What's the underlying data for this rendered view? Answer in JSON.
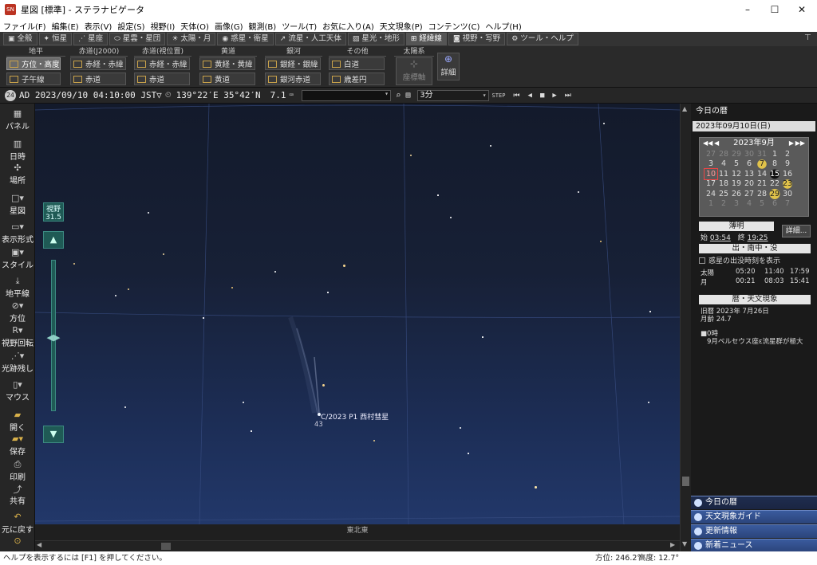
{
  "window": {
    "title": "星図 [標準] - ステラナビゲータ",
    "icon": "app-logo-icon"
  },
  "menu": [
    "ファイル(F)",
    "編集(E)",
    "表示(V)",
    "設定(S)",
    "視野(I)",
    "天体(O)",
    "画像(G)",
    "観測(B)",
    "ツール(T)",
    "お気に入り(A)",
    "天文現象(P)",
    "コンテンツ(C)",
    "ヘルプ(H)"
  ],
  "tabs": [
    {
      "label": "全般",
      "icon": "panel-icon"
    },
    {
      "label": "恒星",
      "icon": "star-icon"
    },
    {
      "label": "星座",
      "icon": "constellation-icon"
    },
    {
      "label": "星雲・星団",
      "icon": "nebula-icon"
    },
    {
      "label": "太陽・月",
      "icon": "sun-icon"
    },
    {
      "label": "惑星・衛星",
      "icon": "planet-icon"
    },
    {
      "label": "流星・人工天体",
      "icon": "meteor-icon"
    },
    {
      "label": "星光・地形",
      "icon": "landscape-icon"
    },
    {
      "label": "経緯線",
      "icon": "grid-icon",
      "active": true
    },
    {
      "label": "視野・写野",
      "icon": "camera-icon"
    },
    {
      "label": "ツール・ヘルプ",
      "icon": "gear-icon"
    }
  ],
  "ribbon": {
    "groups": [
      {
        "label": "地平",
        "buttons": [
          "方位・高度",
          "子午線"
        ]
      },
      {
        "label": "赤道(J2000)",
        "buttons": [
          "赤経・赤緯",
          "赤道"
        ]
      },
      {
        "label": "赤道(視位置)",
        "buttons": [
          "赤経・赤緯",
          "赤道"
        ]
      },
      {
        "label": "黄道",
        "buttons": [
          "黄経・黄緯",
          "黄道"
        ]
      },
      {
        "label": "銀河",
        "buttons": [
          "銀経・銀緯",
          "銀河赤道"
        ]
      },
      {
        "label": "その他",
        "buttons": [
          "白道",
          "歳差円"
        ]
      },
      {
        "label": "太陽系",
        "buttons": [
          "座標軸"
        ]
      }
    ],
    "detail_label": "詳細"
  },
  "toolbar": {
    "datetime": "AD 2023/09/10 04:10:00 JST▽",
    "location": "139°22′E 35°42′N",
    "magnitude": "7.1",
    "search_value": "",
    "step_value": "3分"
  },
  "left_panel": [
    "パネル",
    "日時",
    "場所",
    "星図",
    "表示形式",
    "スタイル",
    "地平線",
    "方位",
    "視野回転",
    "光跡残し",
    "マウス",
    "開く",
    "保存",
    "印刷",
    "共有",
    "元に戻す"
  ],
  "sky": {
    "fov_label": "視野",
    "fov_value": "31.5",
    "comet_label": "C/2023 P1 西村彗星",
    "comet_mag": "43",
    "horizon_label": "東北東"
  },
  "right_panel": {
    "title": "今日の暦",
    "date": "2023年09月10日(日)",
    "calendar": {
      "month_label": "2023年9月",
      "weeks": [
        [
          "27",
          "28",
          "29",
          "30",
          "31",
          "1",
          "2"
        ],
        [
          "3",
          "4",
          "5",
          "6",
          "7",
          "8",
          "9"
        ],
        [
          "10",
          "11",
          "12",
          "13",
          "14",
          "15",
          "16"
        ],
        [
          "17",
          "18",
          "19",
          "20",
          "21",
          "22",
          "23"
        ],
        [
          "24",
          "25",
          "26",
          "27",
          "28",
          "29",
          "30"
        ],
        [
          "1",
          "2",
          "3",
          "4",
          "5",
          "6",
          "7"
        ]
      ]
    },
    "twilight_title": "薄明",
    "twilight_start_label": "始",
    "twilight_start": "03:54",
    "twilight_end_label": "終",
    "twilight_end": "19:25",
    "detail_button": "詳細...",
    "rise_title": "出・南中・没",
    "planet_checkbox": "惑星の出没時刻を表示",
    "sun_label": "太陽",
    "sun_times": [
      "05:20",
      "11:40",
      "17:59"
    ],
    "moon_label": "月",
    "moon_times": [
      "00:21",
      "08:03",
      "15:41"
    ],
    "calendar_title": "暦・天文現象",
    "lunar_date": "旧暦 2023年 7月26日",
    "moon_age": "月齢 24.7",
    "event_time": "■0時",
    "event_text": "9月ペルセウス座ε流星群が極大",
    "bottom_buttons": [
      "今日の暦",
      "天文現象ガイド",
      "更新情報",
      "新着ニュース"
    ]
  },
  "status": {
    "help": "ヘルプを表示するには [F1] を押してください。",
    "azimuth": "方位: 246.2°",
    "altitude": "高度: 12.7°"
  },
  "colors": {
    "accent": "#2c4a8a",
    "gold": "#c9a24a",
    "fov_panel": "#1f5a55"
  }
}
